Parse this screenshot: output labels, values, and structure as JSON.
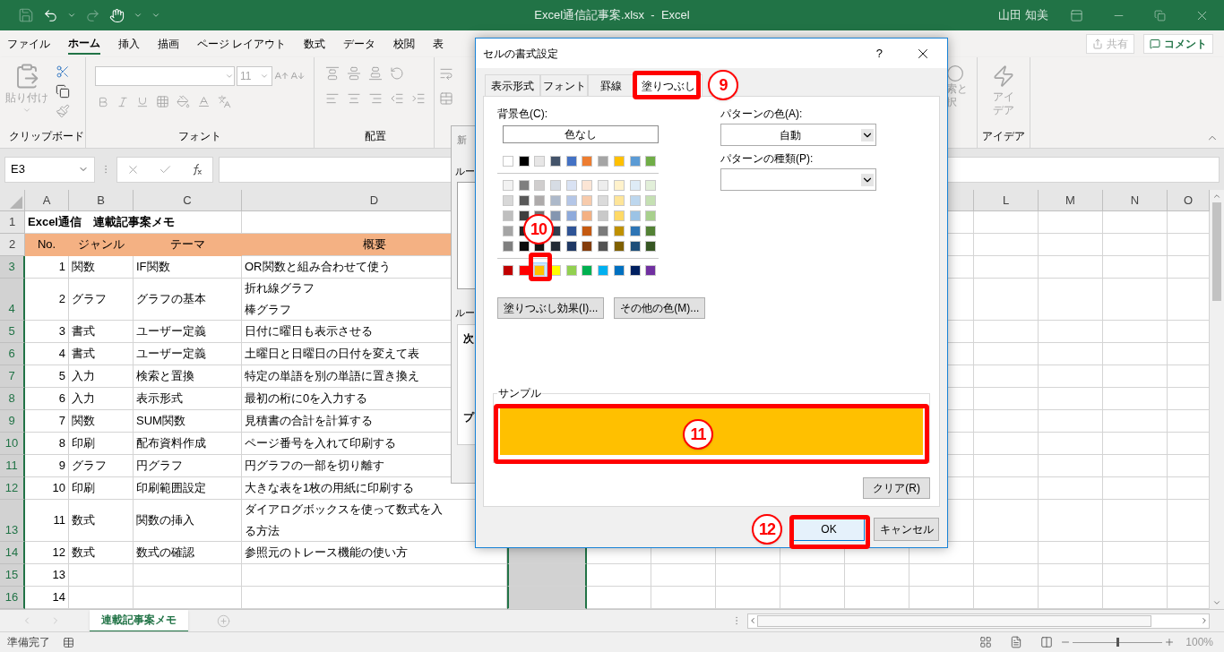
{
  "window": {
    "title": "Excel通信記事案.xlsx  -  Excel",
    "user": "山田 知美"
  },
  "ribbon_tabs": [
    {
      "label": "ファイル",
      "selected": false
    },
    {
      "label": "ホーム",
      "selected": true
    },
    {
      "label": "挿入",
      "selected": false
    },
    {
      "label": "描画",
      "selected": false
    },
    {
      "label": "ページ レイアウト",
      "selected": false
    },
    {
      "label": "数式",
      "selected": false
    },
    {
      "label": "データ",
      "selected": false
    },
    {
      "label": "校閲",
      "selected": false
    },
    {
      "label": "表",
      "selected": false
    }
  ],
  "share_button": "共有",
  "comment_button": "コメント",
  "ribbon": {
    "clipboard": {
      "paste": "貼り付け",
      "label": "クリップボード"
    },
    "font": {
      "size": "11",
      "label": "フォント"
    },
    "alignment": {
      "label": "配置"
    },
    "find": {
      "line_1": "索と",
      "line_2": "択"
    },
    "ideas": {
      "button": "アイデア",
      "label": "アイデア"
    }
  },
  "formula_bar": {
    "name_box": "E3"
  },
  "columns": {
    "left": [
      "A",
      "B",
      "C",
      "D"
    ],
    "right": [
      "L",
      "M",
      "N",
      "O"
    ]
  },
  "rows": [
    {
      "number": "1",
      "kind": "title",
      "selected": false,
      "cells": [
        "Excel通信　連載記事案メモ"
      ]
    },
    {
      "number": "2",
      "kind": "header",
      "selected": false,
      "cells": [
        "No.",
        "ジャンル",
        "テーマ",
        "概要"
      ]
    },
    {
      "number": "3",
      "kind": "data",
      "selected": true,
      "cells": [
        "1",
        "関数",
        "IF関数",
        "OR関数と組み合わせて使う"
      ]
    },
    {
      "number": "4",
      "kind": "data",
      "selected": true,
      "cells": [
        "2",
        "グラフ",
        "グラフの基本",
        [
          "折れ線グラフ",
          "棒グラフ"
        ]
      ]
    },
    {
      "number": "5",
      "kind": "data",
      "selected": true,
      "cells": [
        "3",
        "書式",
        "ユーザー定義",
        "日付に曜日も表示させる"
      ]
    },
    {
      "number": "6",
      "kind": "data",
      "selected": true,
      "cells": [
        "4",
        "書式",
        "ユーザー定義",
        "土曜日と日曜日の日付を変えて表"
      ]
    },
    {
      "number": "7",
      "kind": "data",
      "selected": true,
      "cells": [
        "5",
        "入力",
        "検索と置換",
        "特定の単語を別の単語に置き換え"
      ]
    },
    {
      "number": "8",
      "kind": "data",
      "selected": true,
      "cells": [
        "6",
        "入力",
        "表示形式",
        "最初の桁に0を入力する"
      ]
    },
    {
      "number": "9",
      "kind": "data",
      "selected": true,
      "cells": [
        "7",
        "関数",
        "SUM関数",
        "見積書の合計を計算する"
      ]
    },
    {
      "number": "10",
      "kind": "data",
      "selected": true,
      "cells": [
        "8",
        "印刷",
        "配布資料作成",
        "ページ番号を入れて印刷する"
      ]
    },
    {
      "number": "11",
      "kind": "data",
      "selected": true,
      "cells": [
        "9",
        "グラフ",
        "円グラフ",
        "円グラフの一部を切り離す"
      ]
    },
    {
      "number": "12",
      "kind": "data",
      "selected": true,
      "cells": [
        "10",
        "印刷",
        "印刷範囲設定",
        "大きな表を1枚の用紙に印刷する"
      ]
    },
    {
      "number": "13",
      "kind": "data",
      "selected": true,
      "cells": [
        "11",
        "数式",
        "関数の挿入",
        [
          "ダイアログボックスを使って数式を入",
          "る方法"
        ]
      ]
    },
    {
      "number": "14",
      "kind": "data",
      "selected": true,
      "cells": [
        "12",
        "数式",
        "数式の確認",
        "参照元のトレース機能の使い方"
      ]
    },
    {
      "number": "15",
      "kind": "data",
      "selected": true,
      "cells": [
        "13"
      ]
    },
    {
      "number": "16",
      "kind": "data",
      "selected": true,
      "cells": [
        "14"
      ]
    }
  ],
  "background_dialog": {
    "title": "新",
    "labels": [
      "ルー",
      "ルー"
    ],
    "text_1": "次",
    "text_2": "プ"
  },
  "dialog": {
    "title": "セルの書式設定",
    "help": "?",
    "tabs": [
      {
        "label": "表示形式",
        "selected": false
      },
      {
        "label": "フォント",
        "selected": false
      },
      {
        "label": "罫線",
        "selected": false
      },
      {
        "label": "塗りつぶし",
        "selected": true
      }
    ],
    "background_label": "背景色(C):",
    "no_color": "色なし",
    "theme_colors": [
      {
        "color": "#ffffff",
        "selected": false
      },
      {
        "color": "#000000",
        "selected": false
      },
      {
        "color": "#e7e6e6",
        "selected": false
      },
      {
        "color": "#44546a",
        "selected": false
      },
      {
        "color": "#4472c4",
        "selected": false
      },
      {
        "color": "#ed7d31",
        "selected": false
      },
      {
        "color": "#a5a5a5",
        "selected": false
      },
      {
        "color": "#ffc000",
        "selected": false
      },
      {
        "color": "#5b9bd5",
        "selected": false
      },
      {
        "color": "#70ad47",
        "selected": false
      }
    ],
    "shades": [
      [
        {
          "color": "#f2f2f2",
          "selected": false
        },
        {
          "color": "#7f7f7f",
          "selected": false
        },
        {
          "color": "#d0cece",
          "selected": false
        },
        {
          "color": "#d6dce4",
          "selected": false
        },
        {
          "color": "#d9e2f3",
          "selected": false
        },
        {
          "color": "#fbe5d5",
          "selected": false
        },
        {
          "color": "#ededed",
          "selected": false
        },
        {
          "color": "#fff2cc",
          "selected": false
        },
        {
          "color": "#deebf6",
          "selected": false
        },
        {
          "color": "#e2efd9",
          "selected": false
        }
      ],
      [
        {
          "color": "#d8d8d8",
          "selected": false
        },
        {
          "color": "#595959",
          "selected": false
        },
        {
          "color": "#aeabab",
          "selected": false
        },
        {
          "color": "#adb9ca",
          "selected": false
        },
        {
          "color": "#b4c6e7",
          "selected": false
        },
        {
          "color": "#f7cbac",
          "selected": false
        },
        {
          "color": "#dbdbdb",
          "selected": false
        },
        {
          "color": "#fee599",
          "selected": false
        },
        {
          "color": "#bdd7ee",
          "selected": false
        },
        {
          "color": "#c5e0b3",
          "selected": false
        }
      ],
      [
        {
          "color": "#bfbfbf",
          "selected": false
        },
        {
          "color": "#3f3f3f",
          "selected": false
        },
        {
          "color": "#757070",
          "selected": false
        },
        {
          "color": "#8496b0",
          "selected": false
        },
        {
          "color": "#8eaadb",
          "selected": false
        },
        {
          "color": "#f4b183",
          "selected": false
        },
        {
          "color": "#c9c9c9",
          "selected": false
        },
        {
          "color": "#ffd965",
          "selected": false
        },
        {
          "color": "#9cc3e5",
          "selected": false
        },
        {
          "color": "#a8d08d",
          "selected": false
        }
      ],
      [
        {
          "color": "#a5a5a5",
          "selected": false
        },
        {
          "color": "#262626",
          "selected": false
        },
        {
          "kind": "covered"
        },
        {
          "color": "#323f4f",
          "selected": false
        },
        {
          "color": "#2f5496",
          "selected": false
        },
        {
          "color": "#c55a11",
          "selected": false
        },
        {
          "color": "#7b7b7b",
          "selected": false
        },
        {
          "color": "#bf9000",
          "selected": false
        },
        {
          "color": "#2e75b5",
          "selected": false
        },
        {
          "color": "#538135",
          "selected": false
        }
      ],
      [
        {
          "color": "#7f7f7f",
          "selected": false
        },
        {
          "color": "#0c0c0c",
          "selected": false
        },
        {
          "color": "#171616",
          "selected": false
        },
        {
          "color": "#222a35",
          "selected": false
        },
        {
          "color": "#1f3864",
          "selected": false
        },
        {
          "color": "#833c0b",
          "selected": false
        },
        {
          "color": "#525252",
          "selected": false
        },
        {
          "color": "#7f6000",
          "selected": false
        },
        {
          "color": "#1e4e79",
          "selected": false
        },
        {
          "color": "#375623",
          "selected": false
        }
      ]
    ],
    "standard_colors": [
      {
        "color": "#c00000",
        "selected": false
      },
      {
        "color": "#ff0000",
        "selected": false
      },
      {
        "color": "#ffc000",
        "selected": true
      },
      {
        "color": "#ffff00",
        "selected": false
      },
      {
        "color": "#92d050",
        "selected": false
      },
      {
        "color": "#00b050",
        "selected": false
      },
      {
        "color": "#00b0f0",
        "selected": false
      },
      {
        "color": "#0070c0",
        "selected": false
      },
      {
        "color": "#002060",
        "selected": false
      },
      {
        "color": "#7030a0",
        "selected": false
      }
    ],
    "fill_effects": "塗りつぶし効果(I)...",
    "more_colors": "その他の色(M)...",
    "pattern_color_label": "パターンの色(A):",
    "pattern_color": "自動",
    "pattern_style_label": "パターンの種類(P):",
    "sample_label": "サンプル",
    "clear": "クリア(R)",
    "ok": "OK",
    "cancel": "キャンセル"
  },
  "callouts": [
    {
      "number": "9",
      "kind": "tab"
    },
    {
      "number": "10",
      "kind": "swatch"
    },
    {
      "number": "11",
      "kind": "sample"
    },
    {
      "number": "12",
      "kind": "button"
    }
  ],
  "sheet_tabs": [
    {
      "label": "連載記事案メモ",
      "selected": true
    }
  ],
  "status_bar": {
    "text": "準備完了",
    "zoom": "100%",
    "zoom_slider": {
      "level": 0.5
    }
  }
}
